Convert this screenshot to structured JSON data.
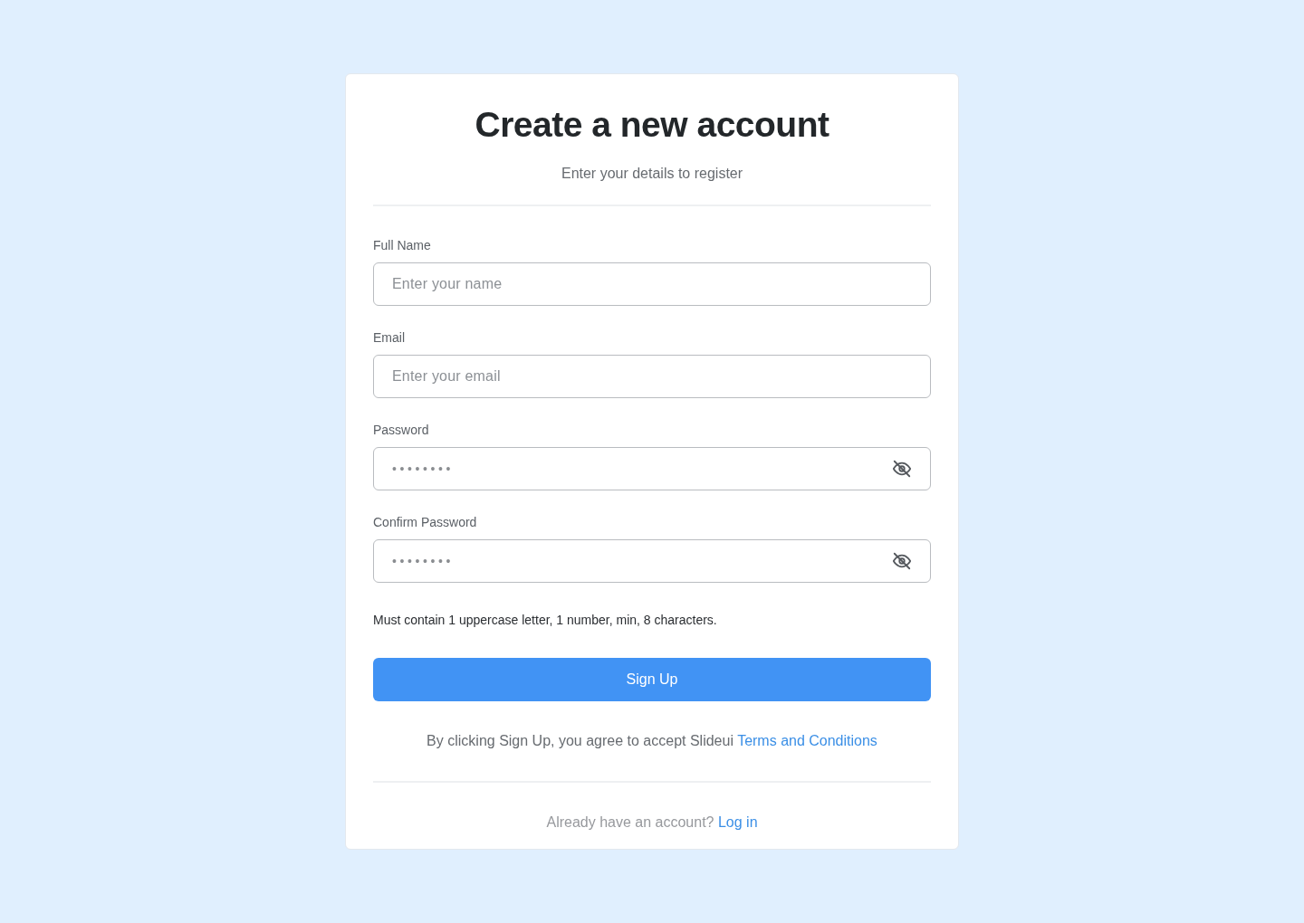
{
  "header": {
    "title": "Create a new account",
    "subtitle": "Enter your details to register"
  },
  "fields": [
    {
      "kind": "text",
      "label": "Full Name",
      "placeholder": "Enter your name"
    },
    {
      "kind": "text",
      "label": "Email",
      "placeholder": "Enter your email"
    },
    {
      "kind": "password",
      "label": "Password",
      "value": "••••••••"
    },
    {
      "kind": "password",
      "label": "Confirm Password",
      "value": "••••••••"
    }
  ],
  "hint": "Must contain 1 uppercase letter, 1 number, min, 8 characters.",
  "submit_button": "Sign Up",
  "terms": {
    "text": "By clicking Sign Up, you agree to accept Slideui",
    "link": "Terms and Conditions"
  },
  "footer": {
    "text": "Already have an account?",
    "link": "Log in"
  }
}
